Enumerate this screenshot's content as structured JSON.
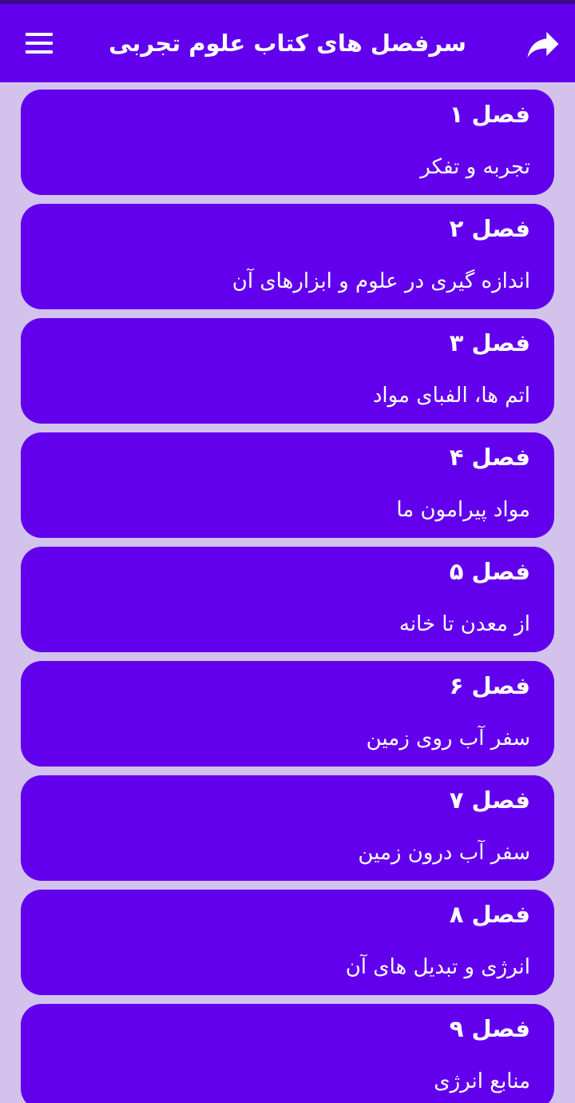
{
  "toolbar": {
    "title": "سرفصل های کتاب علوم تجربی",
    "menu_icon": "hamburger-menu-icon",
    "share_icon": "share-arrow-icon"
  },
  "colors": {
    "primary": "#6200ee",
    "status_bar": "#3a0c8c",
    "background": "#d3c3ec",
    "text": "#ffffff"
  },
  "chapters": [
    {
      "title": "فصل ۱",
      "subtitle": "تجربه و تفکر"
    },
    {
      "title": "فصل ۲",
      "subtitle": "اندازه گیری در علوم و ابزارهای آن"
    },
    {
      "title": "فصل ۳",
      "subtitle": "اتم ها، الفبای مواد"
    },
    {
      "title": "فصل ۴",
      "subtitle": "مواد پیرامون ما"
    },
    {
      "title": "فصل ۵",
      "subtitle": "از معدن تا خانه"
    },
    {
      "title": "فصل ۶",
      "subtitle": "سفر آب روی زمین"
    },
    {
      "title": "فصل ۷",
      "subtitle": "سفر آب درون زمین"
    },
    {
      "title": "فصل ۸",
      "subtitle": "انرژی و تبدیل های آن"
    },
    {
      "title": "فصل ۹",
      "subtitle": "منابع انرژی"
    }
  ]
}
